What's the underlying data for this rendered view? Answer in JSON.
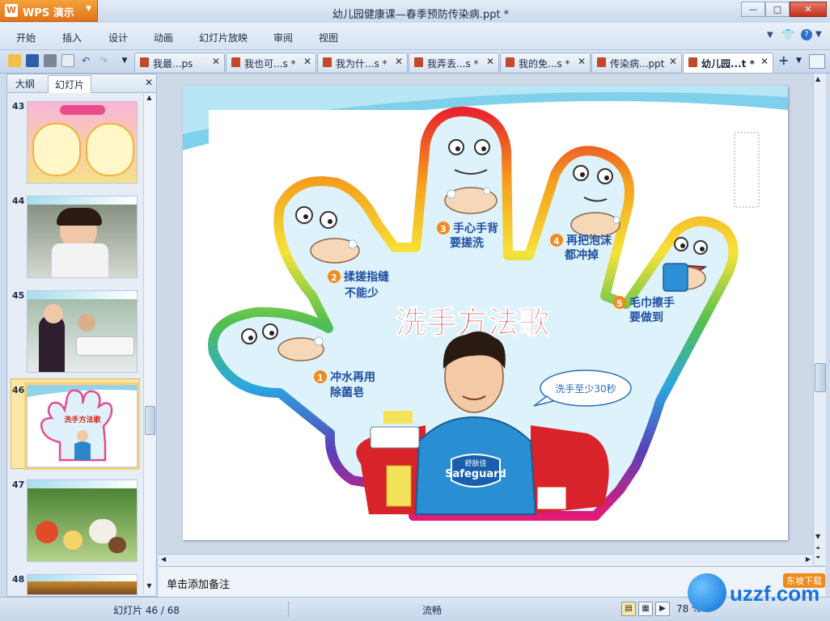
{
  "app": {
    "name": "WPS 演示",
    "logo_glyph": "W",
    "window_title": "幼儿园健康课—春季预防传染病.ppt *"
  },
  "window_controls": {
    "minimize": "—",
    "maximize": "□",
    "close": "✕"
  },
  "menu": [
    "开始",
    "插入",
    "设计",
    "动画",
    "幻灯片放映",
    "审阅",
    "视图"
  ],
  "doc_tabs": [
    {
      "name": "我最...ps",
      "active": false
    },
    {
      "name": "我也可...s *",
      "active": false
    },
    {
      "name": "我为什...s *",
      "active": false
    },
    {
      "name": "我弄丢...s *",
      "active": false
    },
    {
      "name": "我的免...s *",
      "active": false
    },
    {
      "name": "传染病...ppt",
      "active": false
    },
    {
      "name": "幼儿园...t *",
      "active": true
    }
  ],
  "tab_close": "✕",
  "left_panel": {
    "tabs": [
      "大纲",
      "幻灯片"
    ],
    "active_tab": "幻灯片",
    "close": "✕",
    "thumbnails": [
      {
        "number": "43",
        "selected": false
      },
      {
        "number": "44",
        "selected": false
      },
      {
        "number": "45",
        "selected": false
      },
      {
        "number": "46",
        "selected": true
      },
      {
        "number": "47",
        "selected": false
      },
      {
        "number": "48",
        "selected": false
      }
    ]
  },
  "slide": {
    "title": "洗手方法歌",
    "steps": [
      {
        "num": "1",
        "line1": "冲水再用",
        "line2": "除菌皂"
      },
      {
        "num": "2",
        "line1": "揉搓指缝",
        "line2": "不能少"
      },
      {
        "num": "3",
        "line1": "手心手背",
        "line2": "要搓洗"
      },
      {
        "num": "4",
        "line1": "再把泡沫",
        "line2": "都冲掉"
      },
      {
        "num": "5",
        "line1": "毛巾擦手",
        "line2": "要做到"
      }
    ],
    "bubble": "洗手至少30秒",
    "brand_cn": "舒肤佳",
    "brand_en": "Safeguard"
  },
  "notes_placeholder": "单击添加备注",
  "status": {
    "slide_counter": "幻灯片 46 / 68",
    "theme": "流畅",
    "zoom": "78 %"
  },
  "watermark": {
    "text": "uzzf.com",
    "sub": "东坡下载"
  },
  "colors": {
    "accent": "#e3731a",
    "title_red": "#d7261e",
    "selection": "#f5d27a"
  }
}
